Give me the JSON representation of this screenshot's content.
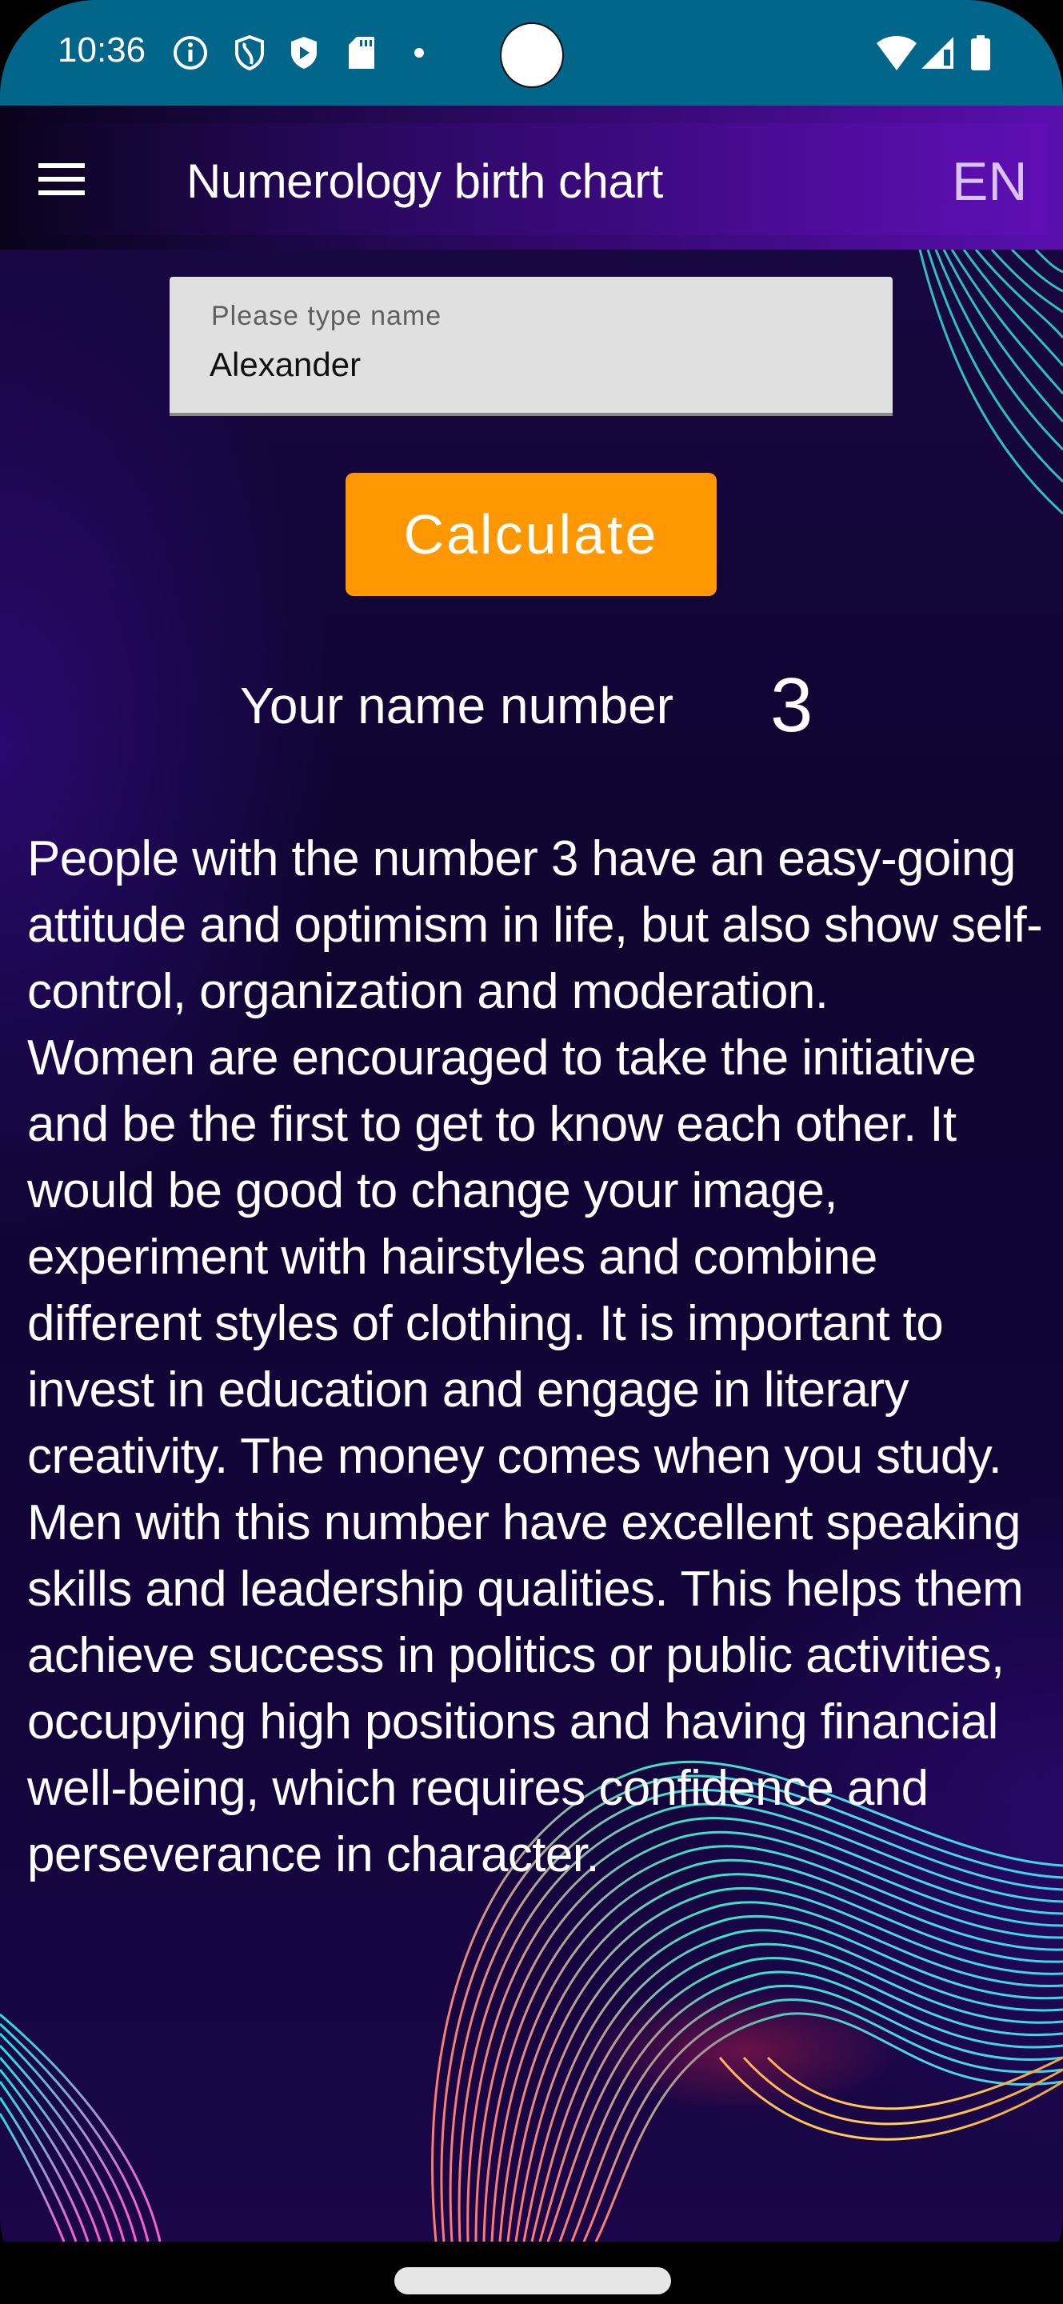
{
  "status_bar": {
    "time": "10:36",
    "left_icons": [
      "info-icon",
      "shield-s-icon",
      "shield-play-icon",
      "sd-card-icon",
      "dot-icon"
    ],
    "right_icons": [
      "wifi-icon",
      "signal-icon",
      "battery-icon"
    ]
  },
  "toolbar": {
    "menu_icon": "hamburger-menu-icon",
    "title": "Numerology birth chart",
    "language": "EN"
  },
  "form": {
    "name_label": "Please type name",
    "name_value": "Alexander",
    "calculate_label": "Calculate"
  },
  "result": {
    "label": "Your name number",
    "value": "3",
    "description": "People with the number 3 have an easy-going attitude and optimism in life, but also show self-control, organization and moderation.\nWomen are encouraged to take the initiative and be the first to get to know each other. It would be good to change your image, experiment with hairstyles and combine different styles of clothing. It is important to invest in education and engage in literary creativity. The money comes when you study.\nMen with this number have excellent speaking skills and leadership qualities. This helps them achieve success in politics or public activities, occupying high positions and having financial well-being, which requires confidence and perseverance in character."
  },
  "colors": {
    "status_bar": "#02668a",
    "accent_button": "#ff9800",
    "toolbar_start": "#09031c",
    "toolbar_end": "#5a0eae",
    "language_text": "#d9c3f0"
  }
}
